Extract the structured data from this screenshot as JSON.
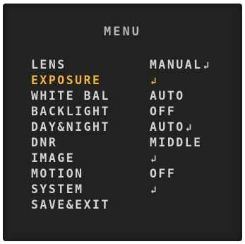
{
  "menu": {
    "title": "MENU",
    "enter_glyph": "↲",
    "items": [
      {
        "label": "LENS",
        "value": "MANUAL",
        "enter": true
      },
      {
        "label": "EXPOSURE",
        "value": "",
        "enter": true,
        "selected": true
      },
      {
        "label": "WHITE BAL",
        "value": "AUTO",
        "enter": false
      },
      {
        "label": "BACKLIGHT",
        "value": "OFF",
        "enter": false
      },
      {
        "label": "DAY&NIGHT",
        "value": "AUTO",
        "enter": true
      },
      {
        "label": "DNR",
        "value": "MIDDLE",
        "enter": false
      },
      {
        "label": "IMAGE",
        "value": "",
        "enter": true
      },
      {
        "label": "MOTION",
        "value": "OFF",
        "enter": false
      },
      {
        "label": "SYSTEM",
        "value": "",
        "enter": true
      },
      {
        "label": "SAVE&EXIT",
        "value": "",
        "enter": false
      }
    ]
  },
  "colors": {
    "background": "#222320",
    "text": "#d4d4d4",
    "highlight": "#f4b443"
  }
}
